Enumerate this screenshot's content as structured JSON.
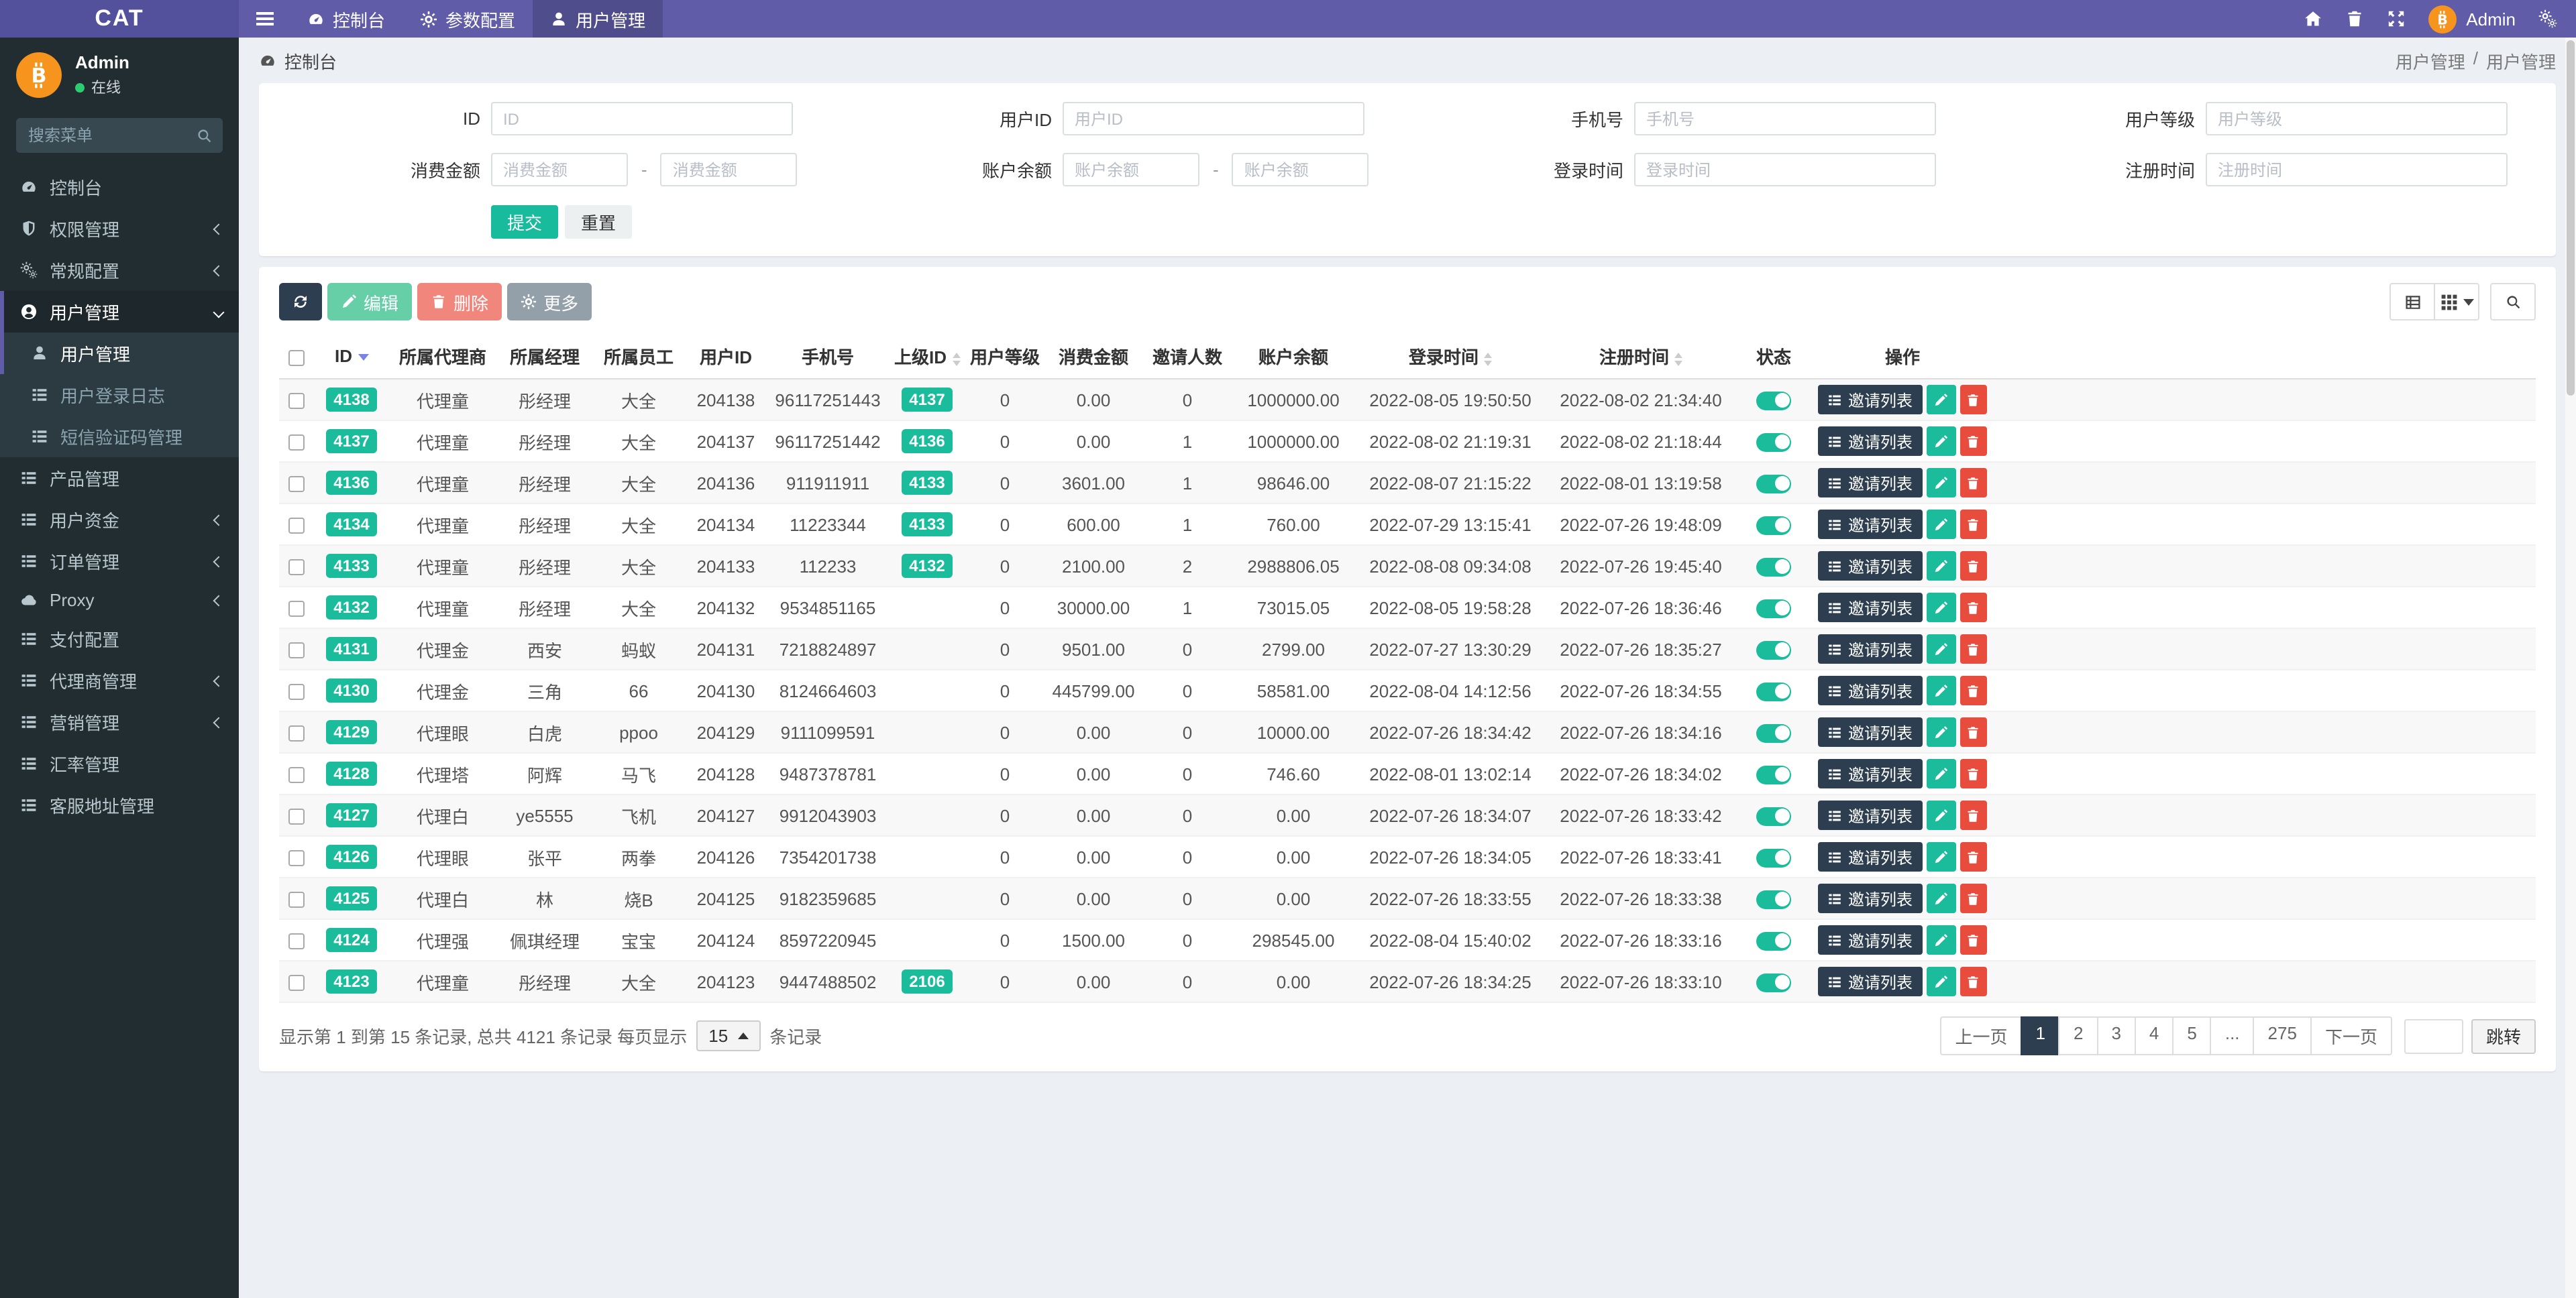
{
  "colors": {
    "navbar": "#605ca8",
    "sidebar": "#222d32",
    "accent": "#1abc9c",
    "dark": "#2c3e50",
    "danger": "#e74c3c",
    "submit": "#18bc9c",
    "avatar": "#f7941d"
  },
  "navbar": {
    "brand": "CAT",
    "items": [
      {
        "label": "控制台",
        "icon": "tachometer",
        "active": false
      },
      {
        "label": "参数配置",
        "icon": "gear",
        "active": false
      },
      {
        "label": "用户管理",
        "icon": "user",
        "active": true
      }
    ],
    "user": "Admin"
  },
  "sidebar": {
    "user_name": "Admin",
    "user_status": "在线",
    "search_placeholder": "搜索菜单",
    "menu": [
      {
        "label": "控制台",
        "icon": "tachometer"
      },
      {
        "label": "权限管理",
        "icon": "shield",
        "arrow": "left"
      },
      {
        "label": "常规配置",
        "icon": "cogs",
        "arrow": "left"
      },
      {
        "label": "用户管理",
        "icon": "user-circle",
        "arrow": "down",
        "active": true,
        "children": [
          {
            "label": "用户管理",
            "icon": "user",
            "active": true
          },
          {
            "label": "用户登录日志",
            "icon": "list"
          },
          {
            "label": "短信验证码管理",
            "icon": "list"
          }
        ]
      },
      {
        "label": "产品管理",
        "icon": "list"
      },
      {
        "label": "用户资金",
        "icon": "list",
        "arrow": "left"
      },
      {
        "label": "订单管理",
        "icon": "list",
        "arrow": "left"
      },
      {
        "label": "Proxy",
        "icon": "cloud",
        "arrow": "left"
      },
      {
        "label": "支付配置",
        "icon": "list"
      },
      {
        "label": "代理商管理",
        "icon": "list",
        "arrow": "left"
      },
      {
        "label": "营销管理",
        "icon": "list",
        "arrow": "left"
      },
      {
        "label": "汇率管理",
        "icon": "list"
      },
      {
        "label": "客服地址管理",
        "icon": "list"
      }
    ]
  },
  "header": {
    "left": "控制台",
    "breadcrumb": [
      "用户管理",
      "用户管理"
    ]
  },
  "filters": {
    "row1": [
      {
        "label": "ID",
        "placeholder": "ID"
      },
      {
        "label": "用户ID",
        "placeholder": "用户ID"
      },
      {
        "label": "手机号",
        "placeholder": "手机号"
      },
      {
        "label": "用户等级",
        "placeholder": "用户等级"
      }
    ],
    "row2": [
      {
        "label": "消费金额",
        "placeholder": "消费金额",
        "range": true
      },
      {
        "label": "账户余额",
        "placeholder": "账户余额",
        "range": true
      },
      {
        "label": "登录时间",
        "placeholder": "登录时间"
      },
      {
        "label": "注册时间",
        "placeholder": "注册时间"
      }
    ],
    "submit": "提交",
    "reset": "重置"
  },
  "toolbar": {
    "edit": "编辑",
    "delete": "删除",
    "more": "更多"
  },
  "table": {
    "invite_btn": "邀请列表",
    "columns": [
      {
        "label": "ID",
        "sort": "desc"
      },
      {
        "label": "所属代理商"
      },
      {
        "label": "所属经理"
      },
      {
        "label": "所属员工"
      },
      {
        "label": "用户ID"
      },
      {
        "label": "手机号"
      },
      {
        "label": "上级ID",
        "sort": "both"
      },
      {
        "label": "用户等级"
      },
      {
        "label": "消费金额"
      },
      {
        "label": "邀请人数"
      },
      {
        "label": "账户余额"
      },
      {
        "label": "登录时间",
        "sort": "both"
      },
      {
        "label": "注册时间",
        "sort": "both"
      },
      {
        "label": "状态"
      },
      {
        "label": "操作"
      }
    ],
    "rows": [
      {
        "id": "4138",
        "agent": "代理童",
        "manager": "彤经理",
        "staff": "大全",
        "uid": "204138",
        "phone": "96117251443",
        "pid": "4137",
        "level": "0",
        "consume": "0.00",
        "invites": "0",
        "balance": "1000000.00",
        "login": "2022-08-05 19:50:50",
        "reg": "2022-08-02 21:34:40"
      },
      {
        "id": "4137",
        "agent": "代理童",
        "manager": "彤经理",
        "staff": "大全",
        "uid": "204137",
        "phone": "96117251442",
        "pid": "4136",
        "level": "0",
        "consume": "0.00",
        "invites": "1",
        "balance": "1000000.00",
        "login": "2022-08-02 21:19:31",
        "reg": "2022-08-02 21:18:44"
      },
      {
        "id": "4136",
        "agent": "代理童",
        "manager": "彤经理",
        "staff": "大全",
        "uid": "204136",
        "phone": "911911911",
        "pid": "4133",
        "level": "0",
        "consume": "3601.00",
        "invites": "1",
        "balance": "98646.00",
        "login": "2022-08-07 21:15:22",
        "reg": "2022-08-01 13:19:58"
      },
      {
        "id": "4134",
        "agent": "代理童",
        "manager": "彤经理",
        "staff": "大全",
        "uid": "204134",
        "phone": "11223344",
        "pid": "4133",
        "level": "0",
        "consume": "600.00",
        "invites": "1",
        "balance": "760.00",
        "login": "2022-07-29 13:15:41",
        "reg": "2022-07-26 19:48:09"
      },
      {
        "id": "4133",
        "agent": "代理童",
        "manager": "彤经理",
        "staff": "大全",
        "uid": "204133",
        "phone": "112233",
        "pid": "4132",
        "level": "0",
        "consume": "2100.00",
        "invites": "2",
        "balance": "2988806.05",
        "login": "2022-08-08 09:34:08",
        "reg": "2022-07-26 19:45:40"
      },
      {
        "id": "4132",
        "agent": "代理童",
        "manager": "彤经理",
        "staff": "大全",
        "uid": "204132",
        "phone": "9534851165",
        "pid": "",
        "level": "0",
        "consume": "30000.00",
        "invites": "1",
        "balance": "73015.05",
        "login": "2022-08-05 19:58:28",
        "reg": "2022-07-26 18:36:46"
      },
      {
        "id": "4131",
        "agent": "代理金",
        "manager": "西安",
        "staff": "蚂蚁",
        "uid": "204131",
        "phone": "7218824897",
        "pid": "",
        "level": "0",
        "consume": "9501.00",
        "invites": "0",
        "balance": "2799.00",
        "login": "2022-07-27 13:30:29",
        "reg": "2022-07-26 18:35:27"
      },
      {
        "id": "4130",
        "agent": "代理金",
        "manager": "三角",
        "staff": "66",
        "uid": "204130",
        "phone": "8124664603",
        "pid": "",
        "level": "0",
        "consume": "445799.00",
        "invites": "0",
        "balance": "58581.00",
        "login": "2022-08-04 14:12:56",
        "reg": "2022-07-26 18:34:55"
      },
      {
        "id": "4129",
        "agent": "代理眼",
        "manager": "白虎",
        "staff": "ppoo",
        "uid": "204129",
        "phone": "9111099591",
        "pid": "",
        "level": "0",
        "consume": "0.00",
        "invites": "0",
        "balance": "10000.00",
        "login": "2022-07-26 18:34:42",
        "reg": "2022-07-26 18:34:16"
      },
      {
        "id": "4128",
        "agent": "代理塔",
        "manager": "阿辉",
        "staff": "马飞",
        "uid": "204128",
        "phone": "9487378781",
        "pid": "",
        "level": "0",
        "consume": "0.00",
        "invites": "0",
        "balance": "746.60",
        "login": "2022-08-01 13:02:14",
        "reg": "2022-07-26 18:34:02"
      },
      {
        "id": "4127",
        "agent": "代理白",
        "manager": "ye5555",
        "staff": "飞机",
        "uid": "204127",
        "phone": "9912043903",
        "pid": "",
        "level": "0",
        "consume": "0.00",
        "invites": "0",
        "balance": "0.00",
        "login": "2022-07-26 18:34:07",
        "reg": "2022-07-26 18:33:42"
      },
      {
        "id": "4126",
        "agent": "代理眼",
        "manager": "张平",
        "staff": "两拳",
        "uid": "204126",
        "phone": "7354201738",
        "pid": "",
        "level": "0",
        "consume": "0.00",
        "invites": "0",
        "balance": "0.00",
        "login": "2022-07-26 18:34:05",
        "reg": "2022-07-26 18:33:41"
      },
      {
        "id": "4125",
        "agent": "代理白",
        "manager": "林",
        "staff": "烧B",
        "uid": "204125",
        "phone": "9182359685",
        "pid": "",
        "level": "0",
        "consume": "0.00",
        "invites": "0",
        "balance": "0.00",
        "login": "2022-07-26 18:33:55",
        "reg": "2022-07-26 18:33:38"
      },
      {
        "id": "4124",
        "agent": "代理强",
        "manager": "佩琪经理",
        "staff": "宝宝",
        "uid": "204124",
        "phone": "8597220945",
        "pid": "",
        "level": "0",
        "consume": "1500.00",
        "invites": "0",
        "balance": "298545.00",
        "login": "2022-08-04 15:40:02",
        "reg": "2022-07-26 18:33:16"
      },
      {
        "id": "4123",
        "agent": "代理童",
        "manager": "彤经理",
        "staff": "大全",
        "uid": "204123",
        "phone": "9447488502",
        "pid": "2106",
        "level": "0",
        "consume": "0.00",
        "invites": "0",
        "balance": "0.00",
        "login": "2022-07-26 18:34:25",
        "reg": "2022-07-26 18:33:10"
      }
    ]
  },
  "footer": {
    "info_prefix": "显示第 1 到第 15 条记录, 总共 4121 条记录 每页显示",
    "page_size": "15",
    "info_suffix": "条记录"
  },
  "pagination": {
    "pages": [
      {
        "label": "上一页"
      },
      {
        "label": "1",
        "active": true
      },
      {
        "label": "2"
      },
      {
        "label": "3"
      },
      {
        "label": "4"
      },
      {
        "label": "5"
      },
      {
        "label": "..."
      },
      {
        "label": "275"
      },
      {
        "label": "下一页"
      }
    ],
    "jump_label": "跳转"
  }
}
